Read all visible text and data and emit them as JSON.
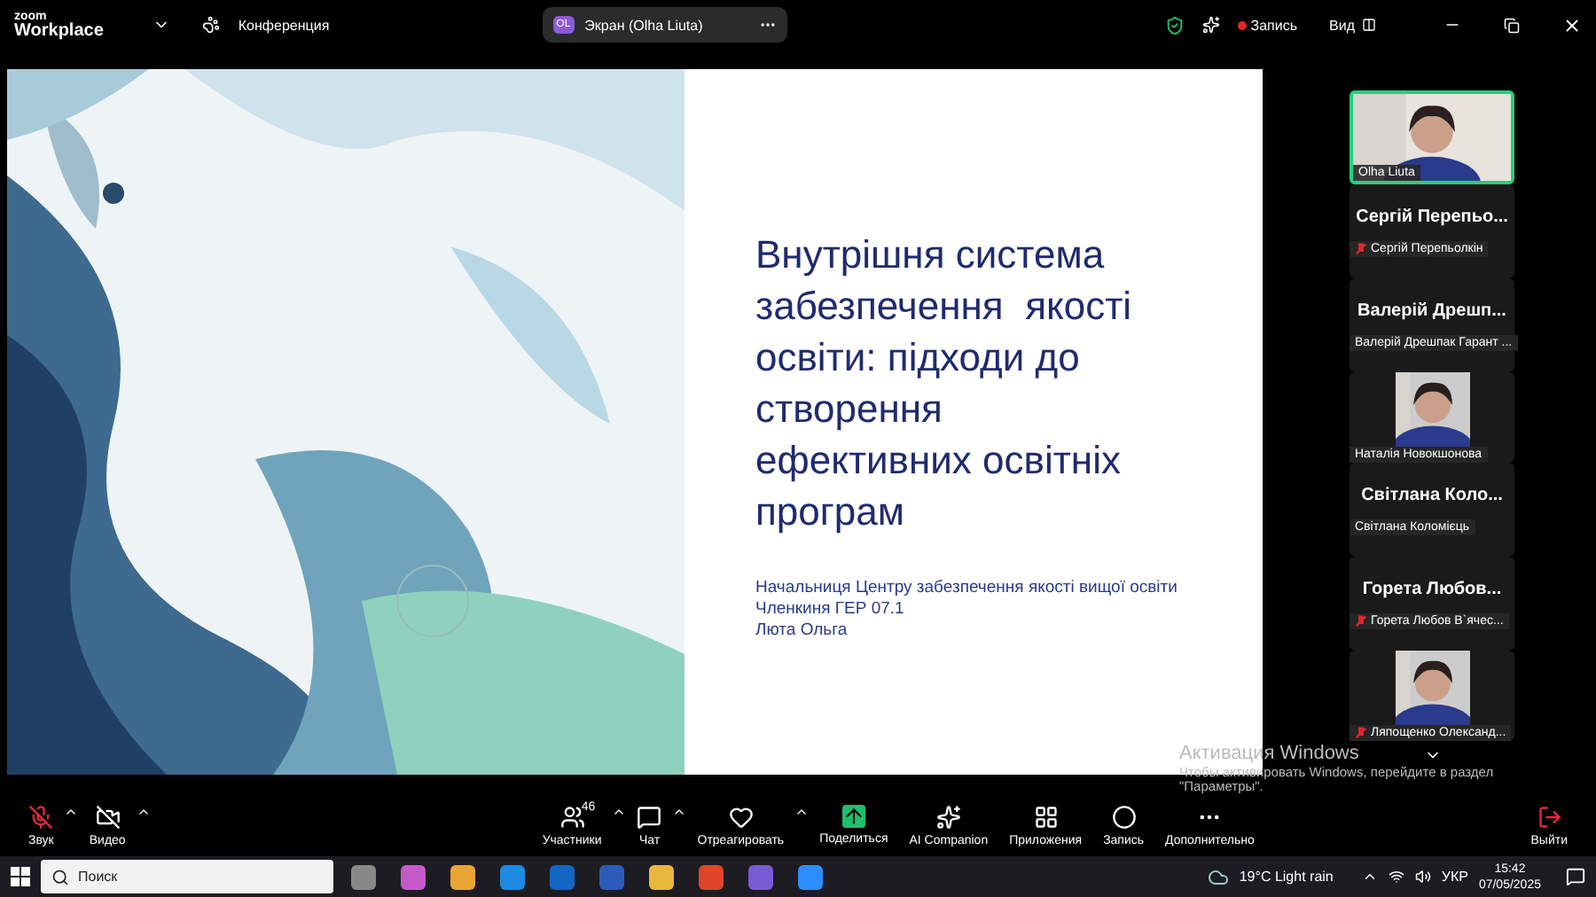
{
  "title_bar": {
    "logo_top": "zoom",
    "logo_bottom": "Workplace",
    "meeting": "Конференция",
    "share_tab": {
      "initials": "OL",
      "label": "Экран (Olha Liuta)"
    },
    "record": "Запись",
    "view": "Вид"
  },
  "slide": {
    "title": "Внутрішня система забезпечення  якості освіти: підходи до створення ефективних освітніх програм",
    "lines": [
      "Начальниця Центру забезпечення якості вищої освіти",
      "Членкиня ГЕР 07.1",
      "Люта Ольга"
    ]
  },
  "participants": [
    {
      "kind": "video",
      "name": "Olha Liuta",
      "muted": false,
      "speaking": true
    },
    {
      "kind": "name",
      "heading": "Сергій Перепьо...",
      "name": "Сергій Перепьолкін",
      "muted": true,
      "speaking": false
    },
    {
      "kind": "name",
      "heading": "Валерій Дрешп...",
      "name": "Валерій Дрешпак Гарант ...",
      "muted": false,
      "speaking": false
    },
    {
      "kind": "video",
      "name": "Наталія Новокшонова",
      "muted": false,
      "speaking": false
    },
    {
      "kind": "name",
      "heading": "Світлана Коло...",
      "name": "Світлана Коломієць",
      "muted": false,
      "speaking": false
    },
    {
      "kind": "name",
      "heading": "Горета Любов...",
      "name": "Горета Любов В`ячес...",
      "muted": true,
      "speaking": false
    },
    {
      "kind": "video",
      "name": "Ляпощенко Олександ...",
      "muted": true,
      "speaking": false
    }
  ],
  "activation": {
    "title": "Активация Windows",
    "text": "Чтобы активировать Windows, перейдите в раздел \"Параметры\"."
  },
  "toolbar": [
    {
      "kind": "mic",
      "label": "Звук",
      "caret": true
    },
    {
      "kind": "video",
      "label": "Видео",
      "caret": true
    },
    {
      "kind": "participants",
      "label": "Участники",
      "count": "46",
      "caret": true
    },
    {
      "kind": "chat",
      "label": "Чат",
      "caret": true
    },
    {
      "kind": "react",
      "label": "Отреагировать",
      "caret": true
    },
    {
      "kind": "share",
      "label": "Поделиться",
      "caret": false
    },
    {
      "kind": "ai",
      "label": "AI Companion",
      "caret": false
    },
    {
      "kind": "apps",
      "label": "Приложения",
      "caret": false
    },
    {
      "kind": "record",
      "label": "Запись",
      "caret": false
    },
    {
      "kind": "more",
      "label": "Дополнительно",
      "caret": false
    },
    {
      "kind": "leave",
      "label": "Выйти",
      "caret": false
    }
  ],
  "taskbar": {
    "search": "Поиск",
    "weather": "19°C  Light rain",
    "language": "УКР",
    "time": "15:42",
    "date": "07/05/2025"
  }
}
